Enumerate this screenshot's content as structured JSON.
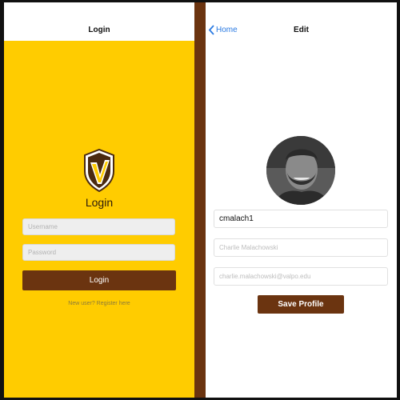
{
  "login_screen": {
    "nav_title": "Login",
    "heading": "Login",
    "username_placeholder": "Username",
    "password_placeholder": "Password",
    "login_button": "Login",
    "register_link": "New user? Register here"
  },
  "edit_screen": {
    "back_label": "Home",
    "nav_title": "Edit",
    "username_value": "cmalach1",
    "name_placeholder": "Charlie Malachowski",
    "email_placeholder": "charlie.malachowski@valpo.edu",
    "save_button": "Save Profile"
  },
  "colors": {
    "brand_gold": "#ffcc00",
    "brand_brown": "#6b3410",
    "link_blue": "#2a7ae2"
  },
  "icons": [
    "valpo-shield-logo-icon",
    "chevron-left-icon",
    "profile-avatar"
  ]
}
